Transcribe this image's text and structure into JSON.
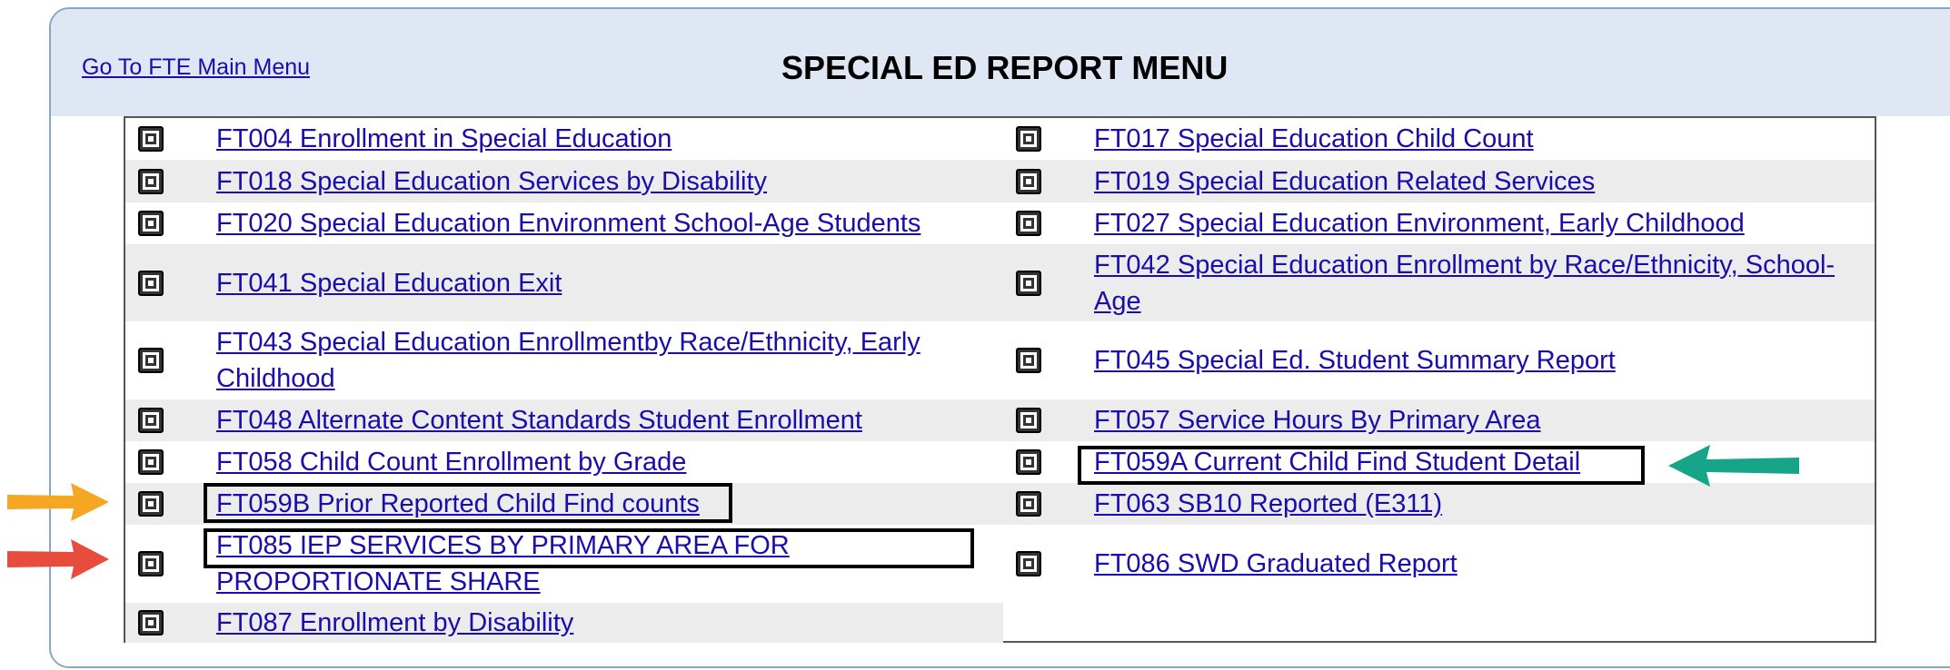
{
  "header": {
    "main_menu_link": "Go To FTE Main Menu",
    "title": "SPECIAL ED REPORT MENU"
  },
  "rows": [
    {
      "left": "FT004 Enrollment in Special Education",
      "right": "FT017 Special Education Child Count"
    },
    {
      "left": "FT018 Special Education Services by Disability",
      "right": "FT019 Special Education Related Services"
    },
    {
      "left": "FT020 Special Education Environment School-Age Students",
      "right": "FT027 Special Education Environment, Early Childhood"
    },
    {
      "left": "FT041 Special Education Exit",
      "right": "FT042 Special Education Enrollment by Race/Ethnicity, School-Age"
    },
    {
      "left": "FT043 Special Education Enrollmentby Race/Ethnicity, Early Childhood",
      "right": "FT045 Special Ed. Student Summary Report"
    },
    {
      "left": "FT048 Alternate Content Standards Student Enrollment",
      "right": "FT057 Service Hours By Primary Area"
    },
    {
      "left": "FT058 Child Count Enrollment by Grade",
      "right": "FT059A Current Child Find Student Detail"
    },
    {
      "left": "FT059B Prior Reported Child Find counts",
      "right": "FT063 SB10 Reported (E311)"
    },
    {
      "left": "FT085 IEP SERVICES BY PRIMARY AREA FOR PROPORTIONATE SHARE",
      "right": "FT086 SWD Graduated Report"
    },
    {
      "left": "FT087 Enrollment by Disability",
      "right": ""
    }
  ],
  "icons": {
    "report": "report-icon",
    "arrow": "arrow-icon"
  },
  "colors": {
    "highlight_green": "#17a589",
    "highlight_orange": "#f5a623",
    "highlight_red": "#e74c3c",
    "link": "#1a0dab",
    "header_bg": "#dfe7f4"
  }
}
